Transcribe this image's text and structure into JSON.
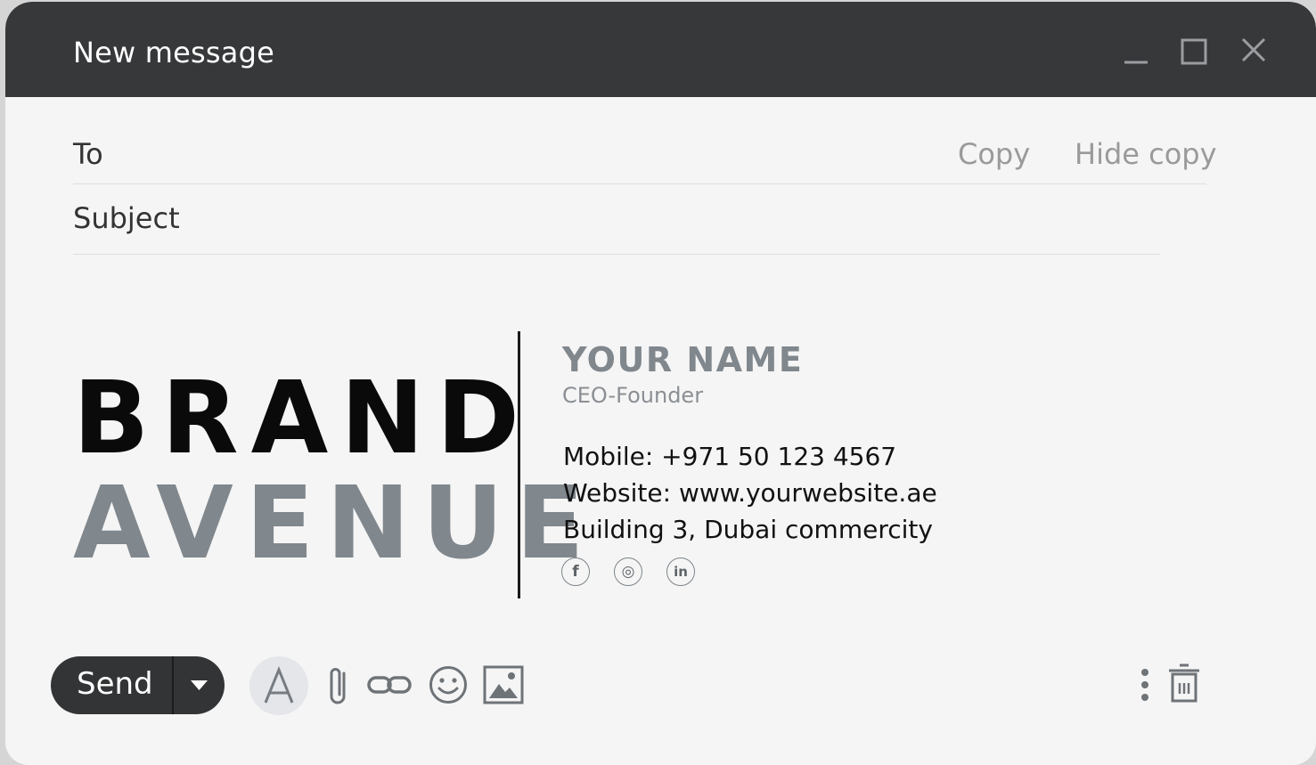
{
  "window": {
    "title": "New message",
    "controls": [
      "minimize-icon",
      "maximize-icon",
      "close-icon"
    ]
  },
  "fields": {
    "to_label": "To",
    "subject_label": "Subject",
    "copy_label": "Copy",
    "hide_copy_label": "Hide copy"
  },
  "signature": {
    "logo_line1": "BRAND",
    "logo_line2": "AVENUE",
    "name": "YOUR NAME",
    "role": "CEO-Founder",
    "mobile": "Mobile: +971 50 123 4567",
    "website": "Website: www.yourwebsite.ae",
    "address": "Building 3, Dubai commercity",
    "socials": [
      {
        "icon": "facebook-icon",
        "glyph": "f"
      },
      {
        "icon": "instagram-icon",
        "glyph": "◎"
      },
      {
        "icon": "linkedin-icon",
        "glyph": "in"
      }
    ]
  },
  "toolbar": {
    "send_label": "Send",
    "format_glyph": "A",
    "tools": [
      "format-text-icon",
      "attach-icon",
      "link-icon",
      "emoji-icon",
      "image-icon",
      "more-options-icon",
      "trash-icon"
    ]
  },
  "colors": {
    "titlebar": "#37383a",
    "body": "#f5f5f5",
    "brand_black": "#0a0a0a",
    "brand_gray": "#80878d",
    "send_button": "#333436"
  }
}
